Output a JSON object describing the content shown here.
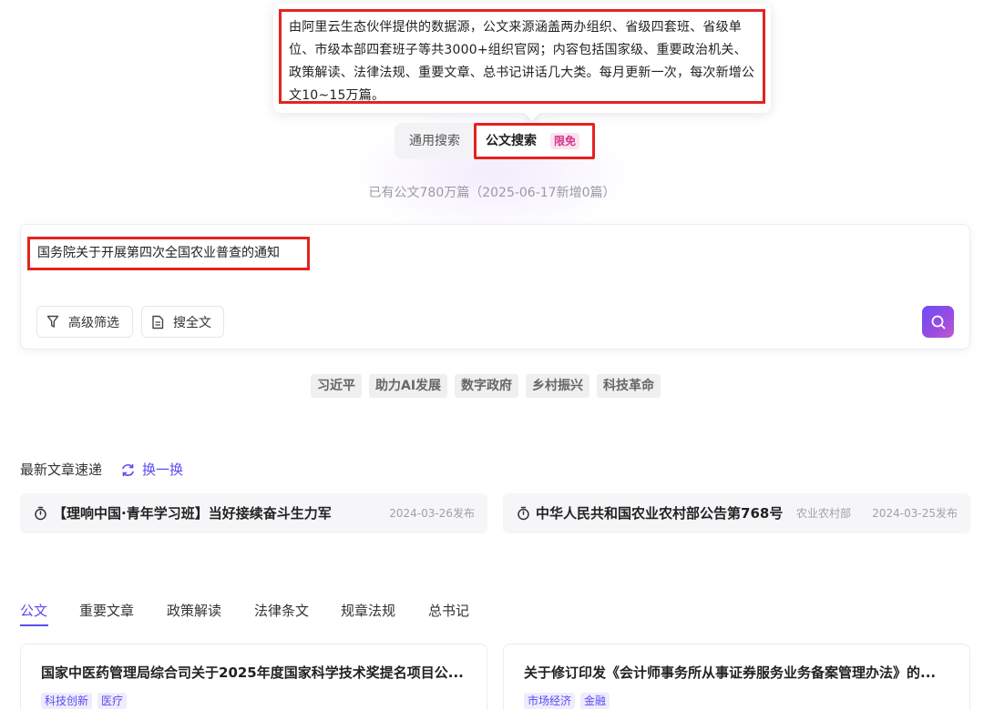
{
  "tooltip": {
    "text": "由阿里云生态伙伴提供的数据源，公文来源涵盖两办组织、省级四套班、省级单位、市级本部四套班子等共3000+组织官网；内容包括国家级、重要政治机关、政策解读、法律法规、重要文章、总书记讲话几大类。每月更新一次，每次新增公文10~15万篇。"
  },
  "search_tabs": {
    "general": "通用搜索",
    "doc": "公文搜索",
    "badge": "限免"
  },
  "stats": "已有公文780万篇（2025-06-17新增0篇）",
  "search": {
    "query": "国务院关于开展第四次全国农业普查的通知",
    "filter_label": "高级筛选",
    "fulltext_label": "搜全文"
  },
  "hot_tags": [
    "习近平",
    "助力AI发展",
    "数字政府",
    "乡村振兴",
    "科技革命"
  ],
  "latest": {
    "title": "最新文章速递",
    "refresh_label": "换一换",
    "items": [
      {
        "title": "【理响中国·青年学习班】当好接续奋斗生力军",
        "source": "",
        "date": "2024-03-26发布"
      },
      {
        "title": "中华人民共和国农业农村部公告第768号",
        "source": "农业农村部",
        "date": "2024-03-25发布"
      }
    ]
  },
  "categories": [
    "公文",
    "重要文章",
    "政策解读",
    "法律条文",
    "规章法规",
    "总书记"
  ],
  "docs": [
    {
      "title": "国家中医药管理局综合司关于2025年度国家科学技术奖提名项目公...",
      "tags": [
        "科技创新",
        "医疗"
      ]
    },
    {
      "title": "关于修订印发《会计师事务所从事证券服务业务备案管理办法》的...",
      "tags": [
        "市场经济",
        "金融"
      ]
    }
  ],
  "colors": {
    "accent": "#5b4cf0",
    "highlight_box": "#e4231f",
    "badge": "#d6338a"
  },
  "icons": {
    "filter": "filter-icon",
    "fulltext": "document-icon",
    "submit": "search-icon",
    "refresh": "refresh-icon",
    "news": "timer-icon"
  }
}
